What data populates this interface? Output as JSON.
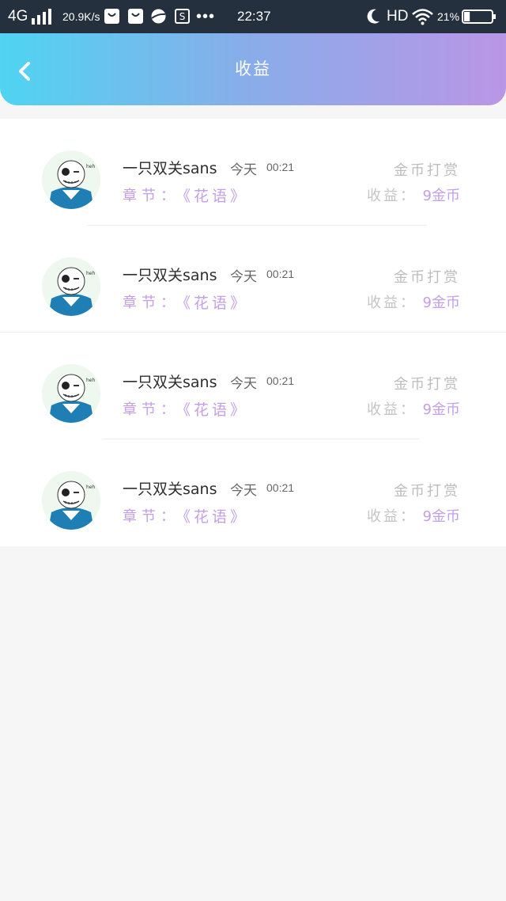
{
  "status_bar": {
    "network": "4G",
    "speed": "20.9K/s",
    "dots": "•••",
    "time": "22:37",
    "hd": "HD",
    "battery": "21%",
    "battery_level": 0.21
  },
  "header": {
    "title": "收益",
    "back_icon": "chevron-left-icon"
  },
  "records": [
    {
      "name": "一只双关sans",
      "date": "今天",
      "time": "00:21",
      "chapter_label": "章节：",
      "chapter": "《花语》",
      "type": "金币打赏",
      "income_label": "收益：",
      "income": "9金币"
    },
    {
      "name": "一只双关sans",
      "date": "今天",
      "time": "00:21",
      "chapter_label": "章节：",
      "chapter": "《花语》",
      "type": "金币打赏",
      "income_label": "收益：",
      "income": "9金币"
    },
    {
      "name": "一只双关sans",
      "date": "今天",
      "time": "00:21",
      "chapter_label": "章节：",
      "chapter": "《花语》",
      "type": "金币打赏",
      "income_label": "收益：",
      "income": "9金币"
    },
    {
      "name": "一只双关sans",
      "date": "今天",
      "time": "00:21",
      "chapter_label": "章节：",
      "chapter": "《花语》",
      "type": "金币打赏",
      "income_label": "收益：",
      "income": "9金币"
    }
  ],
  "colors": {
    "header_gradient_start": "#4fd4f1",
    "header_gradient_end": "#b996e6",
    "accent_purple": "#c49ee8",
    "status_bar": "#25303f"
  }
}
